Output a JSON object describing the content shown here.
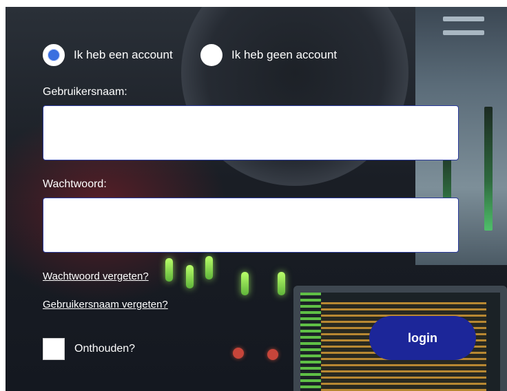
{
  "account_choice": {
    "options": [
      {
        "label": "Ik heb een account",
        "checked": true
      },
      {
        "label": "Ik heb geen account",
        "checked": false
      }
    ]
  },
  "username": {
    "label": "Gebruikersnaam:",
    "value": ""
  },
  "password": {
    "label": "Wachtwoord:",
    "value": ""
  },
  "links": {
    "forgot_password": "Wachtwoord vergeten?",
    "forgot_username": "Gebruikersnaam vergeten?"
  },
  "remember": {
    "label": "Onthouden?",
    "checked": false
  },
  "login_button": {
    "label": "login"
  },
  "colors": {
    "accent": "#1c2699",
    "radio_selected": "#3a6fe0"
  }
}
